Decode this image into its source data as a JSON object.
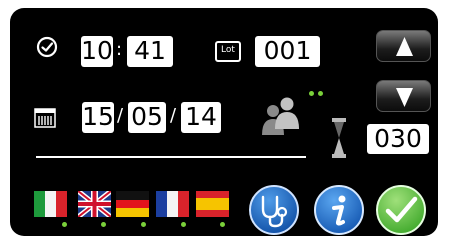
{
  "time": {
    "hours": "10",
    "separator": ":",
    "minutes": "41"
  },
  "lot": {
    "icon_label": "Lot",
    "value": "001"
  },
  "date": {
    "day": "15",
    "month": "05",
    "year": "14",
    "separator": "/"
  },
  "counter": {
    "value": "030"
  },
  "icons": {
    "clock": "clock-icon",
    "lot": "lot-icon",
    "calendar": "calendar-icon",
    "users": "users-icon",
    "hourglass": "hourglass-icon",
    "up": "arrow-up-icon",
    "down": "arrow-down-icon"
  },
  "languages": [
    {
      "code": "it",
      "name": "Italian"
    },
    {
      "code": "gb",
      "name": "English"
    },
    {
      "code": "de",
      "name": "German"
    },
    {
      "code": "fr",
      "name": "French"
    },
    {
      "code": "es",
      "name": "Spanish"
    }
  ],
  "actions": [
    {
      "name": "service",
      "icon": "stethoscope-icon"
    },
    {
      "name": "info",
      "icon": "info-icon"
    },
    {
      "name": "confirm",
      "icon": "checkmark-icon"
    }
  ],
  "colors": {
    "panel": "#000000",
    "indicator_green": "#7ad03a",
    "service_blue": "#1560b8",
    "confirm_green": "#5cc23c"
  }
}
